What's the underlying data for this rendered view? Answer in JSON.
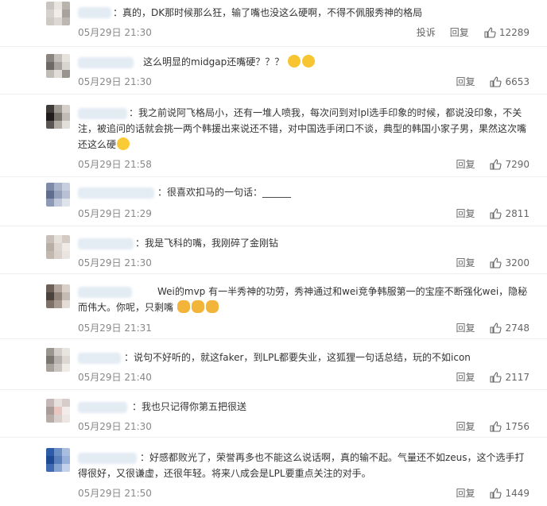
{
  "comments": [
    {
      "name_blur_width": 42,
      "text": "：真的，DK那时候那么狂，输了嘴也没这么硬啊，不得不佩服秀神的格局",
      "time": "05月29日 21:30",
      "report": "投诉",
      "reply": "回复",
      "likes": "12289",
      "avatar_colors": [
        "#c9c4bf",
        "#e8e4e0",
        "#b9b3ae",
        "#d6d1cc",
        "#f0ede9",
        "#a8a29d",
        "#cfc9c3",
        "#ddd8d3",
        "#bdb7b1"
      ]
    },
    {
      "name_blur_width": 70,
      "text": "这么明显的midgap还嘴硬？？？",
      "time": "05月29日 21:30",
      "reply": "回复",
      "likes": "6653",
      "avatar_colors": [
        "#8a8480",
        "#c5bfba",
        "#e6e2de",
        "#6e6965",
        "#a9a39e",
        "#d8d4d0",
        "#c2bcb7",
        "#e0dcd8",
        "#9a948f"
      ]
    },
    {
      "name_blur_width": 62,
      "text": "：我之前说阿飞格局小，还有一堆人喷我，每次问到对lpl选手印象的时候，都说没印象，不关注，被追问的话就会挑一两个韩援出来说还不错，对中国选手闭口不谈，典型的韩国小家子男，果然这次嘴还这么硬",
      "time": "05月29日 21:58",
      "reply": "回复",
      "likes": "7290",
      "avatar_colors": [
        "#3e3a38",
        "#a09a95",
        "#d4cfca",
        "#1f1c1b",
        "#77716c",
        "#c1bbb6",
        "#5a5552",
        "#b0aaa5",
        "#e2ded9"
      ]
    },
    {
      "name_blur_width": 96,
      "text": "：很喜欢扣马的一句话：______",
      "time": "05月29日 21:29",
      "reply": "回复",
      "likes": "2811",
      "avatar_colors": [
        "#7d8aa8",
        "#a9b3c9",
        "#c7cedd",
        "#5f6d8e",
        "#95a0bc",
        "#b8c0d3",
        "#8e99b6",
        "#c2c9da",
        "#dfe3ec"
      ]
    },
    {
      "name_blur_width": 70,
      "text": "：我是飞科的嘴，我刚碎了金刚钻",
      "time": "05月29日 21:30",
      "reply": "回复",
      "likes": "3200",
      "avatar_colors": [
        "#c8bfb8",
        "#e6e0db",
        "#d3cbc4",
        "#b7aea6",
        "#ddd6d0",
        "#efeae6",
        "#c1b8b0",
        "#d9d2cb",
        "#e9e4df"
      ]
    },
    {
      "name_blur_width": 68,
      "text": "Wei的mvp 有一半秀神的功劳，秀神通过和wei竞争韩服第一的宝座不断强化wei，隐秘而伟大。你呢，只剩嘴",
      "time": "05月29日 21:31",
      "reply": "回复",
      "likes": "2748",
      "avatar_colors": [
        "#6b5f58",
        "#b2a69d",
        "#d9d0c9",
        "#4c423c",
        "#8f837a",
        "#c6bbb2",
        "#7d7168",
        "#a79b92",
        "#e4ddd7"
      ]
    },
    {
      "name_blur_width": 54,
      "text": "：说句不好听的，就这faker，到LPL都要失业，这狐狸一句话总结，玩的不如icon",
      "time": "05月29日 21:40",
      "reply": "回复",
      "likes": "2117",
      "avatar_colors": [
        "#9b958f",
        "#d2cdc8",
        "#e8e4e0",
        "#7c7671",
        "#b8b2ac",
        "#dcd7d2",
        "#a7a19b",
        "#cac4be",
        "#efebe7"
      ]
    },
    {
      "name_blur_width": 62,
      "text": "：我也只记得你第五把很送",
      "time": "05月29日 21:30",
      "reply": "回复",
      "likes": "1756",
      "avatar_colors": [
        "#c4b9b6",
        "#e7e0de",
        "#d6cdca",
        "#a89d99",
        "#e9c7c0",
        "#f1ebe9",
        "#b8aca8",
        "#d9d0cd",
        "#ece6e4"
      ]
    },
    {
      "name_blur_width": 74,
      "text": "：好感都败光了，荣誉再多也不能这么说话啊，真的输不起。气量还不如zeus，这个选手打得很好，又很谦虚，还很年轻。将来八成会是LPL要重点关注的对手。",
      "time": "05月29日 21:50",
      "reply": "回复",
      "likes": "1449",
      "avatar_colors": [
        "#2c5ca8",
        "#6d8fc6",
        "#a8bde0",
        "#1d4a93",
        "#5a7fbc",
        "#97b0d9",
        "#3f69b0",
        "#86a3d2",
        "#c3d2ea"
      ]
    }
  ]
}
